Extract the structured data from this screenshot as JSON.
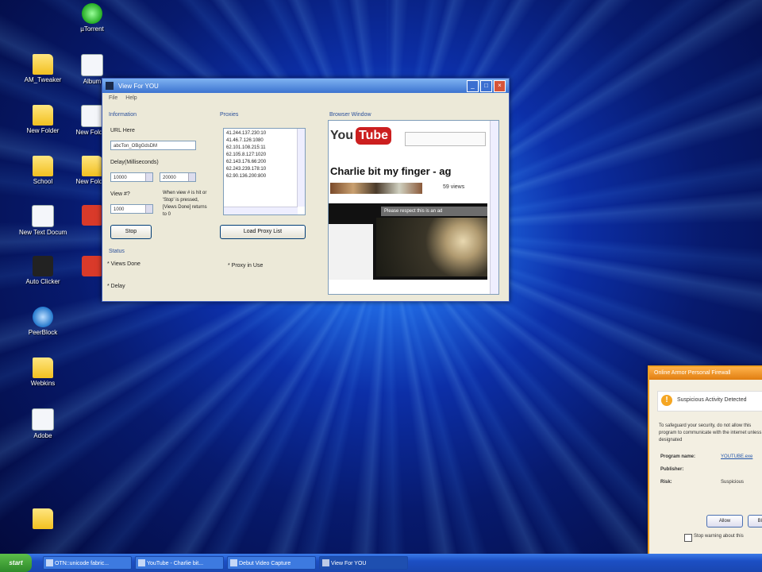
{
  "desktop": {
    "icons": [
      {
        "label": "µTorrent",
        "kind": "green"
      },
      {
        "label": "AM_Tweaker",
        "kind": "folder"
      },
      {
        "label": "Album",
        "kind": "doc"
      },
      {
        "label": "New Folder",
        "kind": "folder"
      },
      {
        "label": "New Folder",
        "kind": "doc"
      },
      {
        "label": "School",
        "kind": "folder"
      },
      {
        "label": "New Folder",
        "kind": "folder"
      },
      {
        "label": "New Text Document",
        "kind": "doc"
      },
      {
        "label": "",
        "kind": "red"
      },
      {
        "label": "Auto Clicker",
        "kind": "dark"
      },
      {
        "label": "",
        "kind": "red"
      },
      {
        "label": "PeerBlock",
        "kind": "globe"
      },
      {
        "label": "Webkins",
        "kind": "folder"
      },
      {
        "label": "Adobe",
        "kind": "doc"
      },
      {
        "label": "",
        "kind": "folder"
      }
    ]
  },
  "window": {
    "title": "View For YOU",
    "menu": [
      "File",
      "Help"
    ],
    "information_label": "Information",
    "url_label": "URL Here",
    "url_value": "abcTon_OBgGdsDM",
    "delay_label": "Delay(Milliseconds)",
    "delay_min": "10000",
    "delay_max": "20000",
    "views_label": "View #?",
    "views_value": "1000",
    "note": "When view # is hit or 'Stop' is pressed, [Views Done] returns to 0",
    "stop_button": "Stop",
    "status_label": "Status",
    "views_done": "* Views Done",
    "delay_status": "* Delay",
    "proxies_label": "Proxies",
    "proxies": [
      "41.244.137.230:10",
      "41.46.7.126:1080",
      "62.101.108.215:11",
      "62.105.8.127:1020",
      "62.143.176.66:200",
      "62.243.239.178:10",
      "62.90.136.200:800"
    ],
    "proxy_in_use": "* Proxy in Use",
    "load_proxy_button": "Load Proxy List",
    "browser_label": "Browser Window",
    "browser": {
      "brand_you": "You",
      "brand_tube": "Tube",
      "video_title": "Charlie bit my finger - ag",
      "views": "59 views",
      "ad_text": "Please respect this is an ad"
    }
  },
  "security_dialog": {
    "title": "Online Armor Personal Firewall",
    "heading": "Suspicious Activity Detected",
    "body": "To safeguard your security, do not allow this program to communicate with the internet unless designated",
    "program_label": "Program name:",
    "program_value": "YOUTUBE.exe",
    "publisher_label": "Publisher:",
    "publisher_value": "",
    "risk_label": "Risk:",
    "risk_value": "Suspicious",
    "allow_button": "Allow",
    "block_button": "Block",
    "remember_label": "Stop warning about this"
  },
  "taskbar": {
    "start": "start",
    "items": [
      "OTN::unicode fabric...",
      "YouTube - Charlie bit...",
      "Debut Video Capture",
      "View For YOU"
    ]
  }
}
